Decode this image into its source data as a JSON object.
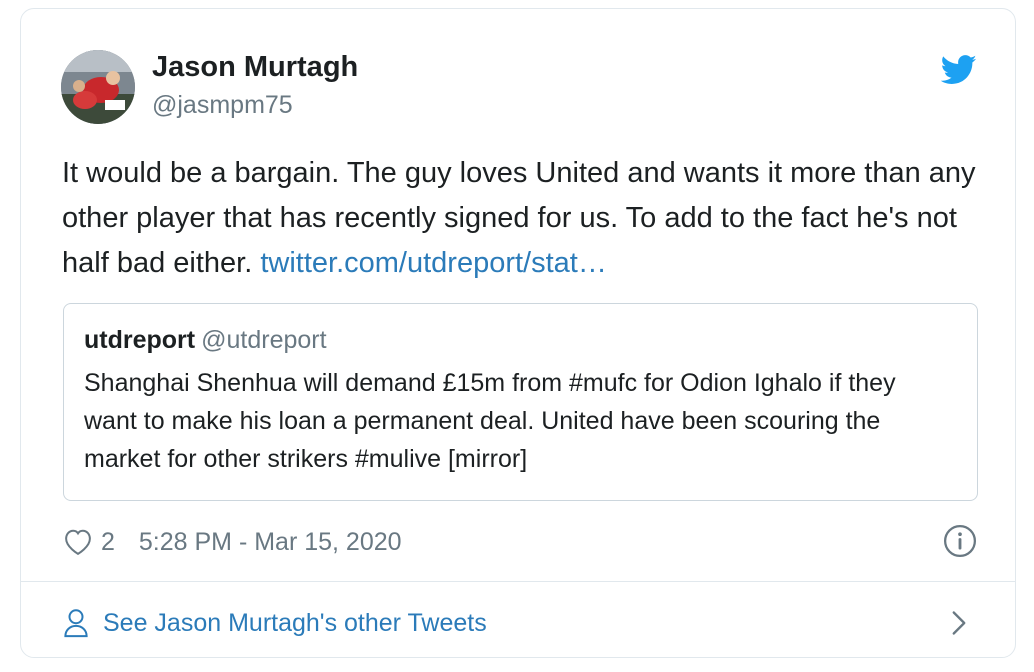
{
  "author": {
    "name": "Jason Murtagh",
    "handle": "@jasmpm75"
  },
  "tweet": {
    "text": "It would be a bargain. The guy loves United and wants it more than any other player that has recently signed for us. To add to the fact he's not half bad either. ",
    "link": "twitter.com/utdreport/stat…"
  },
  "quoted_tweet": {
    "name": "utdreport",
    "handle": "@utdreport",
    "text": "Shanghai Shenhua will demand £15m from #mufc for Odion Ighalo if they want to make his loan a permanent deal. United have been scouring the market for other strikers #mulive [mirror]"
  },
  "meta": {
    "likes": "2",
    "timestamp": "5:28 PM - Mar 15, 2020"
  },
  "footer": {
    "label": "See Jason Murtagh's other Tweets"
  },
  "icons": {
    "brand": "twitter-bird-icon",
    "like": "heart-icon",
    "info": "info-icon",
    "profile": "person-icon",
    "more": "chevron-right-icon"
  },
  "colors": {
    "link": "#2b7bb9",
    "brand": "#1da1f2",
    "muted": "#697882",
    "text": "#1c2022",
    "border": "#e1e8ed"
  }
}
